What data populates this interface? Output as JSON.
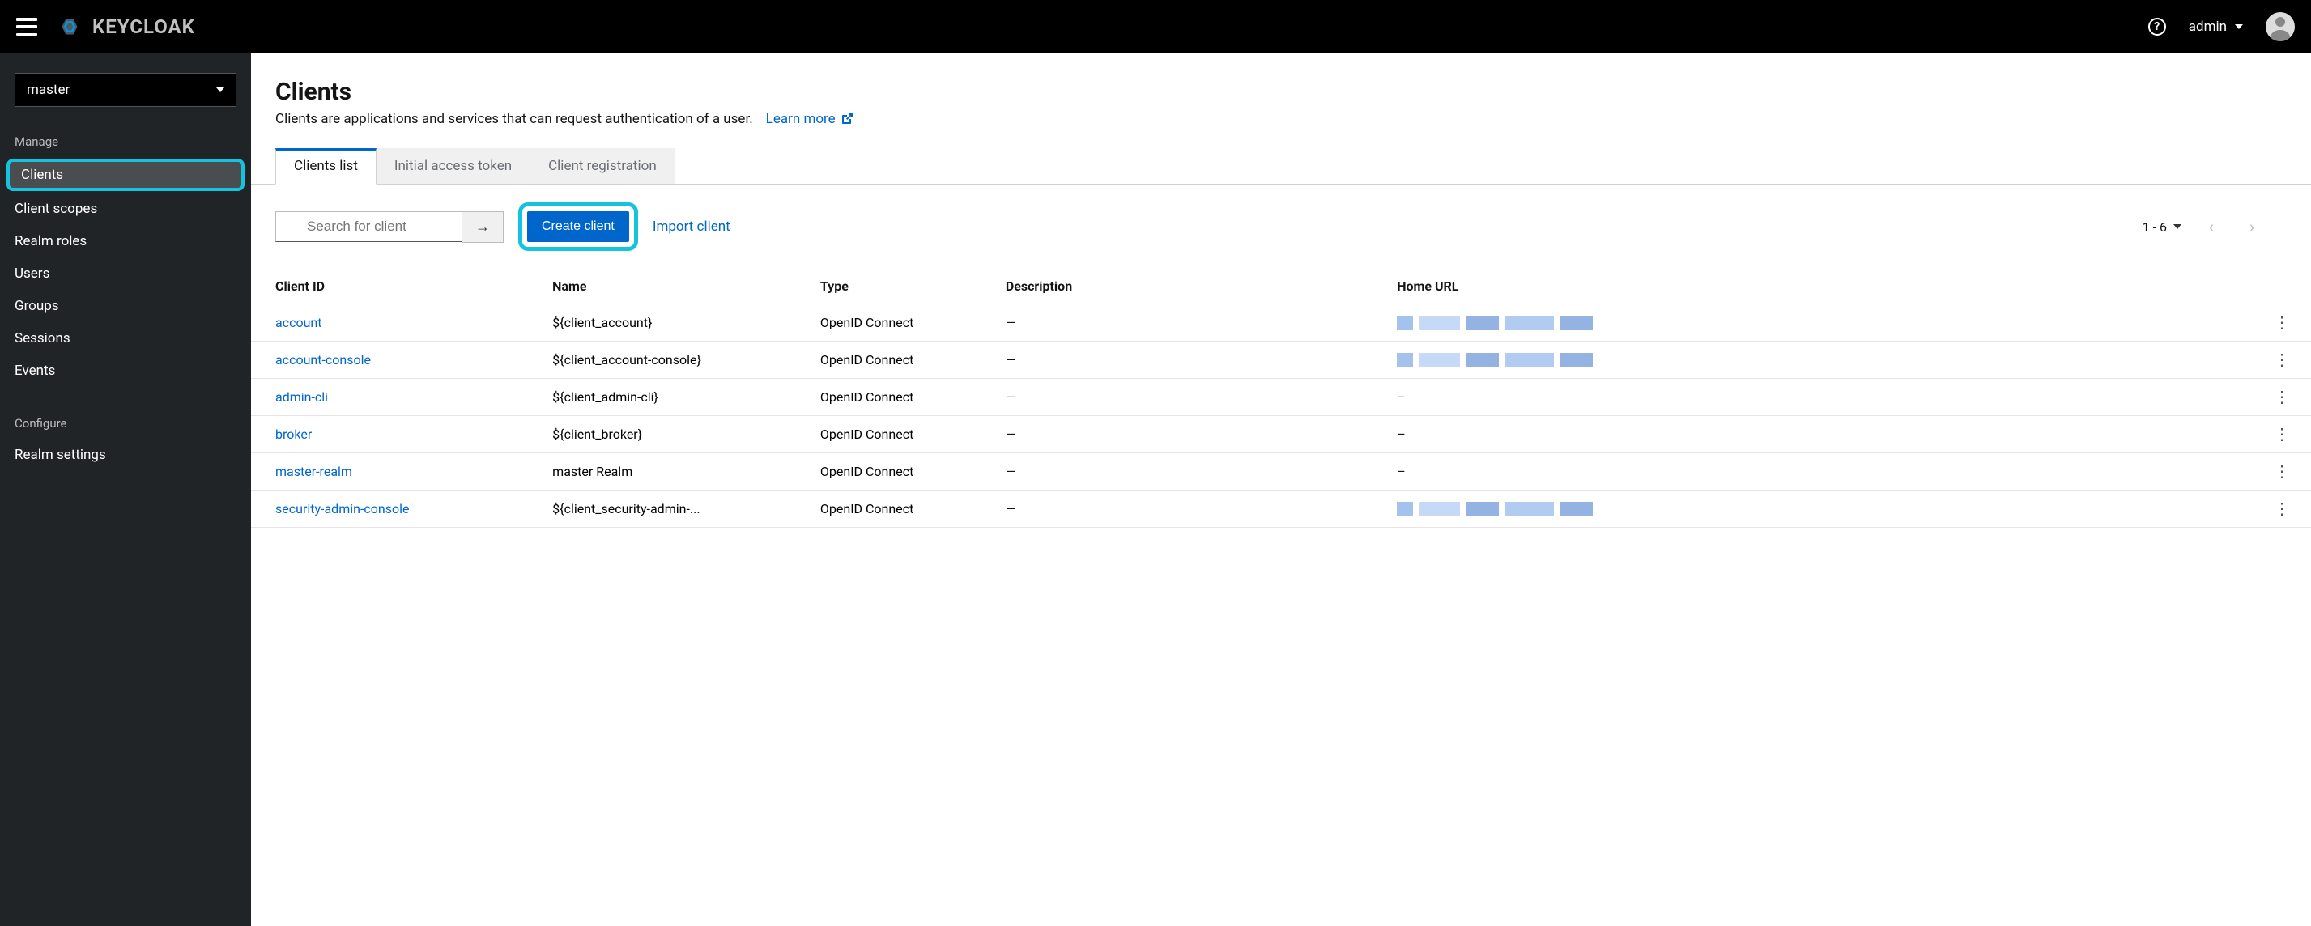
{
  "header": {
    "brand": "KEYCLOAK",
    "user": "admin"
  },
  "sidebar": {
    "realm": "master",
    "sections": [
      {
        "label": "Manage",
        "items": [
          {
            "label": "Clients",
            "active": true
          },
          {
            "label": "Client scopes"
          },
          {
            "label": "Realm roles"
          },
          {
            "label": "Users"
          },
          {
            "label": "Groups"
          },
          {
            "label": "Sessions"
          },
          {
            "label": "Events"
          }
        ]
      },
      {
        "label": "Configure",
        "items": [
          {
            "label": "Realm settings"
          }
        ]
      }
    ]
  },
  "page": {
    "title": "Clients",
    "description": "Clients are applications and services that can request authentication of a user.",
    "learn_more": "Learn more"
  },
  "tabs": [
    {
      "label": "Clients list",
      "active": true
    },
    {
      "label": "Initial access token"
    },
    {
      "label": "Client registration"
    }
  ],
  "toolbar": {
    "search_placeholder": "Search for client",
    "create_label": "Create client",
    "import_label": "Import client",
    "pagination_text": "1 - 6"
  },
  "table": {
    "columns": [
      "Client ID",
      "Name",
      "Type",
      "Description",
      "Home URL"
    ],
    "rows": [
      {
        "id": "account",
        "name": "${client_account}",
        "type": "OpenID Connect",
        "desc": "—",
        "url_type": "img"
      },
      {
        "id": "account-console",
        "name": "${client_account-console}",
        "type": "OpenID Connect",
        "desc": "—",
        "url_type": "img"
      },
      {
        "id": "admin-cli",
        "name": "${client_admin-cli}",
        "type": "OpenID Connect",
        "desc": "—",
        "url_type": "dash"
      },
      {
        "id": "broker",
        "name": "${client_broker}",
        "type": "OpenID Connect",
        "desc": "—",
        "url_type": "dash"
      },
      {
        "id": "master-realm",
        "name": "master Realm",
        "type": "OpenID Connect",
        "desc": "—",
        "url_type": "dash"
      },
      {
        "id": "security-admin-console",
        "name": "${client_security-admin-...",
        "type": "OpenID Connect",
        "desc": "—",
        "url_type": "img"
      }
    ]
  }
}
